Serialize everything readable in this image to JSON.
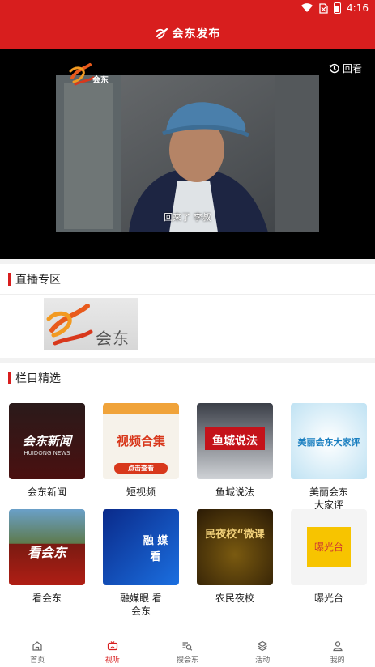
{
  "status_bar": {
    "time": "4:16",
    "icons": [
      "wifi-icon",
      "sim-off-icon",
      "battery-icon"
    ]
  },
  "app_bar": {
    "title": "会东发布",
    "logo": "app-logo-icon"
  },
  "player": {
    "replay_label": "回看",
    "channel_logo_text": "会东",
    "subtitle": "回来了  李叔"
  },
  "live_section": {
    "title": "直播专区",
    "channel_label": "会东"
  },
  "columns_section": {
    "title": "栏目精选",
    "items": [
      {
        "caption": "会东新闻",
        "thumb_text": "会东新闻",
        "thumb_sub": "HUIDONG NEWS"
      },
      {
        "caption": "短视频",
        "thumb_text": "视频合集",
        "thumb_sub": "点击查看"
      },
      {
        "caption": "鱼城说法",
        "thumb_text": "鱼城说法"
      },
      {
        "caption": "美丽会东\n大家评",
        "thumb_text": "美丽会东大家评"
      },
      {
        "caption": "看会东",
        "thumb_text": "看会东"
      },
      {
        "caption": "融媒眼 看\n会东",
        "thumb_text": "融 媒\n看"
      },
      {
        "caption": "农民夜校",
        "thumb_text": "民夜校“微课"
      },
      {
        "caption": "曝光台",
        "thumb_text": "曝光台"
      }
    ]
  },
  "tabbar": {
    "tabs": [
      {
        "label": "首页",
        "icon": "home-icon"
      },
      {
        "label": "视听",
        "icon": "tv-icon"
      },
      {
        "label": "搜会东",
        "icon": "search-list-icon"
      },
      {
        "label": "活动",
        "icon": "layers-icon"
      },
      {
        "label": "我的",
        "icon": "user-icon"
      }
    ]
  },
  "colors": {
    "brand": "#d81e1e",
    "tab_active": "#d81e1e",
    "tab_inactive": "#666666"
  }
}
